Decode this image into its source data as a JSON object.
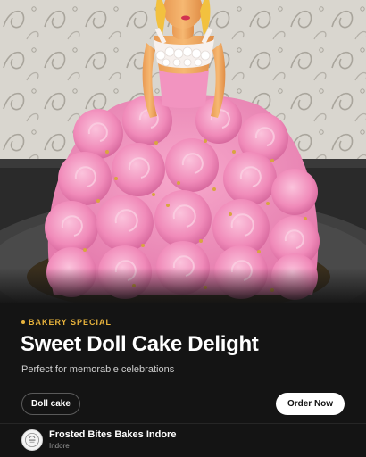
{
  "hero": {
    "image_icon": "doll-cake-photo"
  },
  "promo": {
    "eyebrow": "BAKERY SPECIAL",
    "title": "Sweet Doll Cake Delight",
    "subtitle": "Perfect for memorable celebrations",
    "tag_label": "Doll cake",
    "order_label": "Order Now"
  },
  "bakery": {
    "name": "Frosted Bites Bakes Indore",
    "location": "Indore",
    "avatar_icon": "bakery-logo-icon"
  },
  "colors": {
    "accent": "#e8b33c",
    "background": "#141414",
    "frosting": "#f28bb8",
    "button": "#ffffff"
  }
}
